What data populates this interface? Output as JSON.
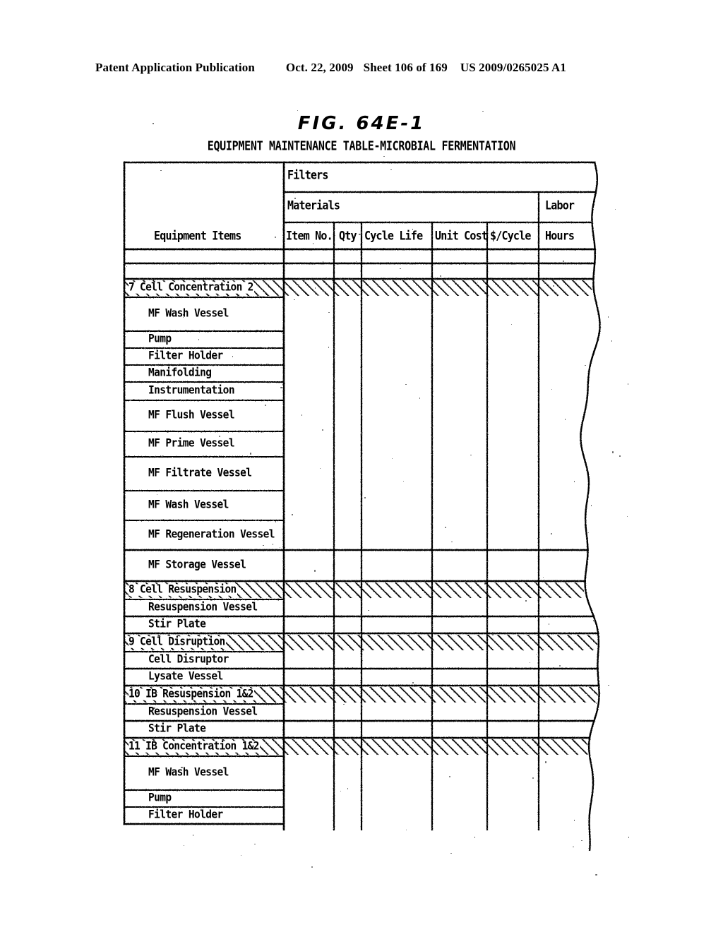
{
  "publication": {
    "left": "Patent Application Publication",
    "date": "Oct. 22, 2009",
    "sheet": "Sheet 106 of 169",
    "patent_number": "US 2009/0265025 A1"
  },
  "figure": {
    "label": "FIG. 64E-1",
    "caption": "EQUIPMENT MAINTENANCE TABLE-MICROBIAL FERMENTATION"
  },
  "table": {
    "group_headers": {
      "filters": "Filters",
      "materials": "Materials",
      "labor": "Labor"
    },
    "columns": [
      {
        "key": "equipment",
        "label": "Equipment Items"
      },
      {
        "key": "item_no",
        "label": "Item No."
      },
      {
        "key": "qty",
        "label": "Qty"
      },
      {
        "key": "cycle_life",
        "label": "Cycle Life"
      },
      {
        "key": "unit_cost",
        "label": "Unit Cost"
      },
      {
        "key": "per_cycle",
        "label": "$/Cycle"
      },
      {
        "key": "hours",
        "label": "Hours"
      }
    ],
    "rows": [
      {
        "type": "blank",
        "label": ""
      },
      {
        "type": "blank",
        "label": ""
      },
      {
        "type": "section",
        "label": "7 Cell Concentration 2"
      },
      {
        "type": "item",
        "label": "MF Wash Vessel"
      },
      {
        "type": "item",
        "label": "Pump"
      },
      {
        "type": "item",
        "label": "Filter Holder"
      },
      {
        "type": "item",
        "label": "Manifolding"
      },
      {
        "type": "item",
        "label": "Instrumentation"
      },
      {
        "type": "item",
        "label": "MF Flush Vessel"
      },
      {
        "type": "item",
        "label": "MF Prime Vessel"
      },
      {
        "type": "item",
        "label": "MF Filtrate Vessel"
      },
      {
        "type": "item",
        "label": "MF Wash Vessel"
      },
      {
        "type": "item",
        "label": "MF Regeneration Vessel"
      },
      {
        "type": "item",
        "label": "MF Storage Vessel"
      },
      {
        "type": "section",
        "label": "8 Cell Resuspension"
      },
      {
        "type": "item",
        "label": "Resuspension Vessel"
      },
      {
        "type": "item",
        "label": "Stir Plate"
      },
      {
        "type": "section",
        "label": "9 Cell Disruption"
      },
      {
        "type": "item",
        "label": "Cell Disruptor"
      },
      {
        "type": "item",
        "label": "Lysate Vessel"
      },
      {
        "type": "section",
        "label": "10 IB Resuspension 1&2"
      },
      {
        "type": "item",
        "label": "Resuspension Vessel"
      },
      {
        "type": "item",
        "label": "Stir Plate"
      },
      {
        "type": "section",
        "label": "11 IB Concentration 1&2"
      },
      {
        "type": "item",
        "label": "MF Wash Vessel"
      },
      {
        "type": "item",
        "label": "Pump"
      },
      {
        "type": "item",
        "label": "Filter Holder"
      }
    ]
  },
  "colors": {
    "ink": "#000000",
    "paper": "#ffffff"
  }
}
